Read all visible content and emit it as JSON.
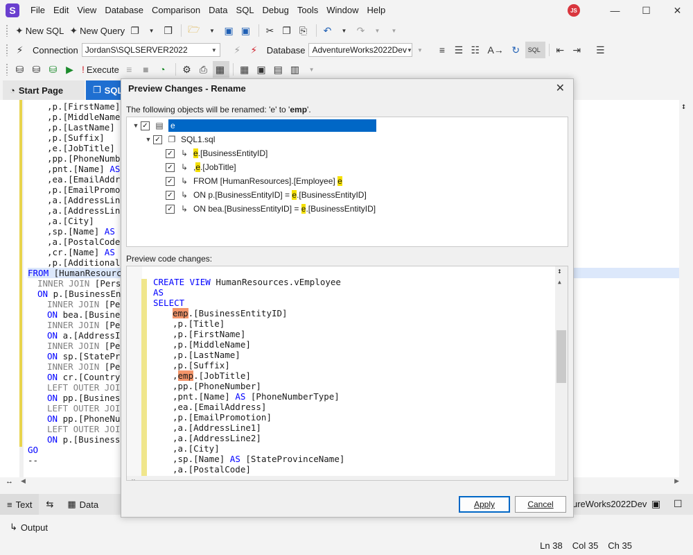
{
  "app": {
    "logo_letter": "S"
  },
  "menu": [
    "File",
    "Edit",
    "View",
    "Database",
    "Comparison",
    "Data",
    "SQL",
    "Debug",
    "Tools",
    "Window",
    "Help"
  ],
  "user_initials": "JS",
  "toolbar1": {
    "new_sql": "New SQL",
    "new_query": "New Query"
  },
  "toolbar2": {
    "connection_label": "Connection",
    "connection_value": "JordanS\\SQLSERVER2022",
    "database_label": "Database",
    "database_value": "AdventureWorks2022Dev"
  },
  "toolbar3": {
    "execute": "Execute"
  },
  "tabs": {
    "start_page": "Start Page",
    "sql": "SQL"
  },
  "editor_lines": [
    ",p.[FirstName]",
    ",p.[MiddleName]",
    ",p.[LastName]",
    ",p.[Suffix]",
    ",e.[JobTitle]",
    ",pp.[PhoneNumbe",
    ",pnt.[Name] AS",
    ",ea.[EmailAddre",
    ",p.[EmailPromot",
    ",a.[AddressLine",
    ",a.[AddressLine",
    ",a.[City]",
    ",sp.[Name] AS [",
    ",a.[PostalCode]",
    ",cr.[Name] AS [",
    ",p.[AdditionalC",
    "FROM [HumanResource",
    "INNER JOIN [Perso",
    "ON p.[BusinessEnt",
    "INNER JOIN [Per",
    "ON bea.[Busines",
    "INNER JOIN [Per",
    "ON a.[AddressID",
    "INNER JOIN [Per",
    "ON sp.[StatePro",
    "INNER JOIN [Per",
    "ON cr.[CountryR",
    "LEFT OUTER JOIN",
    "ON pp.[BusinessE",
    "LEFT OUTER JOIN",
    "ON pp.[PhoneNum",
    "LEFT OUTER JOIN",
    "ON p.[BusinessE",
    "GO",
    "--"
  ],
  "dialog": {
    "title": "Preview Changes - Rename",
    "desc_prefix": "The following objects will be renamed: '",
    "old_name": "e",
    "desc_mid": "' to '",
    "new_name": "emp",
    "desc_suffix": "'.",
    "tree_root": "e",
    "tree_file": "SQL1.sql",
    "tree_items": [
      {
        "before": "",
        "mark": "e",
        "after": ".[BusinessEntityID]"
      },
      {
        "before": ",",
        "mark": "e",
        "after": ".[JobTitle]"
      },
      {
        "before": "FROM [HumanResources].[Employee] ",
        "mark": "e",
        "after": ""
      },
      {
        "before": "ON p.[BusinessEntityID] = ",
        "mark": "e",
        "after": ".[BusinessEntityID]"
      },
      {
        "before": "ON bea.[BusinessEntityID] = ",
        "mark": "e",
        "after": ".[BusinessEntityID]"
      }
    ],
    "preview_label": "Preview code changes:",
    "apply": "Apply",
    "cancel": "Cancel"
  },
  "preview": {
    "l1_kw1": "CREATE VIEW",
    "l1_rest": " HumanResources.vEmployee",
    "l2": "AS",
    "l3": "SELECT",
    "l4_emp": "emp",
    "l4_rest": ".[BusinessEntityID]",
    "lines": [
      ",p.[Title]",
      ",p.[FirstName]",
      ",p.[MiddleName]",
      ",p.[LastName]",
      ",p.[Suffix]"
    ],
    "l10_pre": ",",
    "l10_emp": "emp",
    "l10_rest": ".[JobTitle]",
    "lines2": [
      ",pp.[PhoneNumber]",
      ",pnt.[Name] AS [PhoneNumberType]",
      ",ea.[EmailAddress]",
      ",p.[EmailPromotion]",
      ",a.[AddressLine1]",
      ",a.[AddressLine2]",
      ",a.[City]",
      ",sp.[Name] AS [StateProvinceName]",
      ",a.[PostalCode]"
    ]
  },
  "bottom": {
    "text_tab": "Text",
    "data_tab": "Data",
    "db_name": "ureWorks2022Dev",
    "output": "Output"
  },
  "status": {
    "ln": "Ln 38",
    "col": "Col 35",
    "ch": "Ch 35"
  }
}
